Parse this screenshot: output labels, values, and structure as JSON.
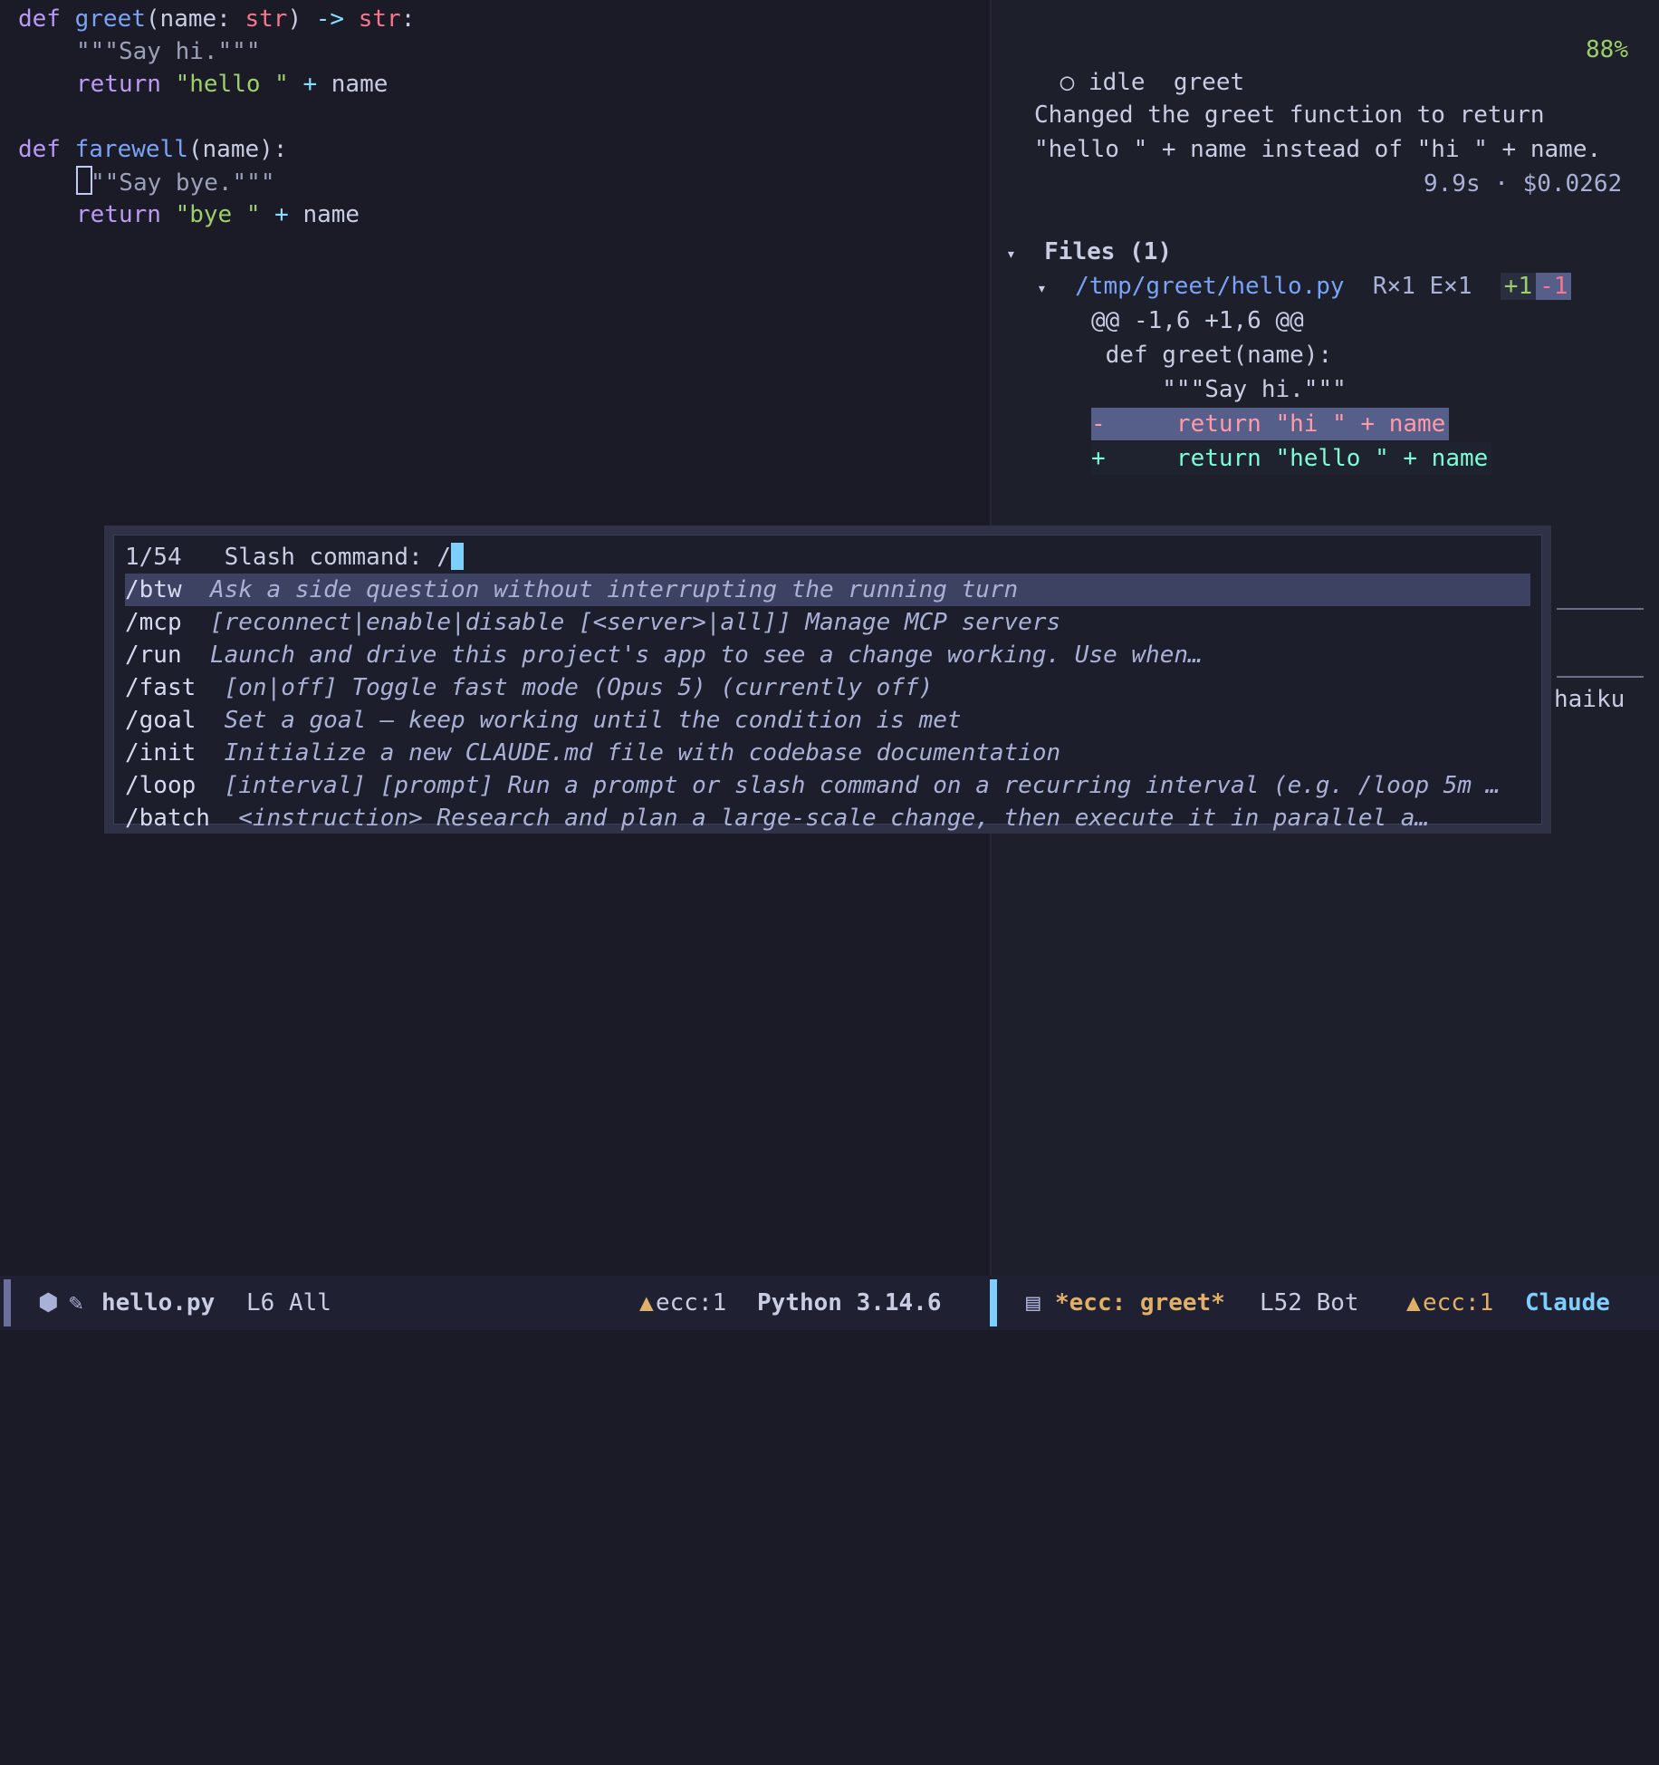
{
  "editor": {
    "lines": [
      {
        "kw": "def",
        "fn": "greet",
        "p1": "(name: ",
        "ty1": "str",
        "p2": ") ",
        "op": "->",
        "sp": " ",
        "ty2": "str",
        "end": ":"
      },
      {
        "doc": "\"\"\"Say hi.\"\"\""
      },
      {
        "kw": "return",
        "str": "\"hello \"",
        "op": "+",
        "rest": "name"
      },
      {
        "kw": "def",
        "fn": "farewell",
        "rest": "(name):"
      },
      {
        "doc_rest": "\"\"Say bye.\"\"\""
      },
      {
        "kw": "return",
        "str": "\"bye \"",
        "op": "+",
        "rest": "name"
      }
    ]
  },
  "agent": {
    "state_icon": "○",
    "state": "idle",
    "session": "greet",
    "percent": "88%",
    "message_line1": "Changed the greet function to return",
    "message_line2": "\"hello \" + name instead of \"hi \" + name.",
    "stats": "9.9s · $0.0262",
    "files_header": "Files (1)",
    "file_path": "/tmp/greet/hello.py",
    "file_reads": "R×1",
    "file_edits": "E×1",
    "added": "+1",
    "removed": "-1",
    "hunk": "@@ -1,6 +1,6 @@",
    "ctx1": " def greet(name):",
    "ctx2": "     \"\"\"Say hi.\"\"\"",
    "del_line": "-     return \"hi \" + name",
    "add_line": "+     return \"hello \" + name",
    "partial_text": "haiku"
  },
  "popup": {
    "counter": "1/54",
    "prompt": "Slash command: /",
    "items": [
      {
        "cmd": "/btw",
        "desc": "Ask a side question without interrupting the running turn"
      },
      {
        "cmd": "/mcp",
        "desc": "[reconnect|enable|disable [<server>|all]] Manage MCP servers"
      },
      {
        "cmd": "/run",
        "desc": "Launch and drive this project's app to see a change working. Use when…"
      },
      {
        "cmd": "/fast",
        "desc": "[on|off] Toggle fast mode (Opus 5) (currently off)"
      },
      {
        "cmd": "/goal",
        "desc": "Set a goal — keep working until the condition is met"
      },
      {
        "cmd": "/init",
        "desc": "Initialize a new CLAUDE.md file with codebase documentation"
      },
      {
        "cmd": "/loop",
        "desc": "[interval] [prompt] Run a prompt or slash command on a recurring interval (e.g. /loop 5m …"
      },
      {
        "cmd": "/batch",
        "desc": "<instruction> Research and plan a large-scale change, then execute it in parallel a…"
      }
    ]
  },
  "status_left": {
    "filename": "hello.py",
    "position": "L6 All",
    "warnings": "ecc:1",
    "python": "Python 3.14.6"
  },
  "status_right": {
    "buffer": "*ecc: greet*",
    "position": "L52 Bot",
    "warnings": "ecc:1",
    "mode": "Claude"
  },
  "colors": {
    "accent_mark_left": "#6b6f9a",
    "accent_mark_right": "#7dcfff",
    "warning": "#e0af68"
  }
}
